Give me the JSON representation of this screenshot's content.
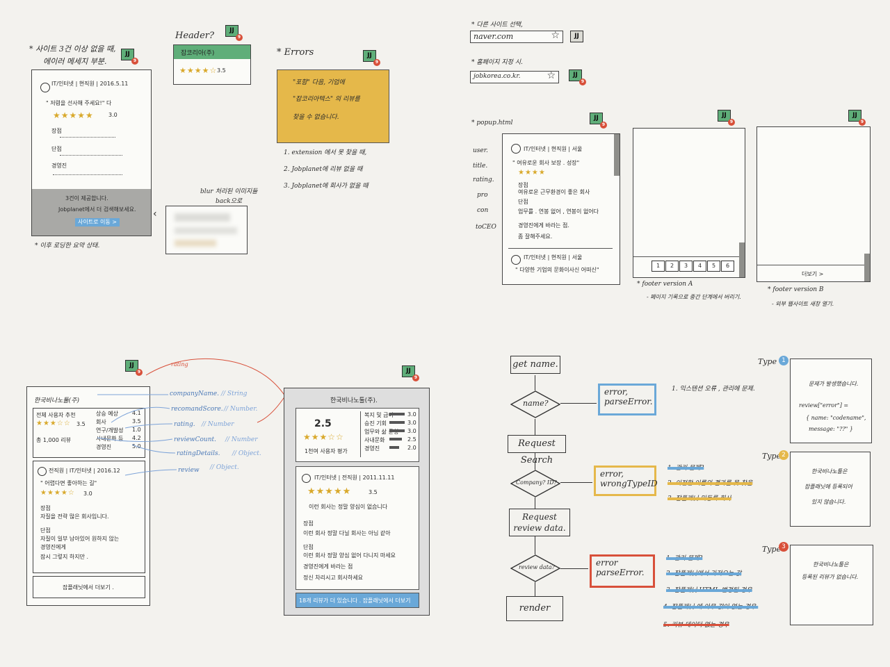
{
  "q1": {
    "note_top": "* 사이트 3건 이상 없을 때,",
    "note_top2": "에이러 메세지 부분.",
    "jj": "JJ",
    "card_review_header": "IT/인터넷 | 현직원 | 2016.5.11",
    "card_review_title": "\" 저렴을 선사해 주세요!\" 다",
    "card_score": "3.0",
    "label_pros": "장점",
    "label_cons": "단점",
    "label_wish": "경영진",
    "gray_line1": "3건이 제공합니다.",
    "gray_line2": "Jobplanet에서 더 검색해보세요.",
    "gray_button": "사이트로 이동 >",
    "note_bottom": "* 이후 로딩한 요약 상태.",
    "side_note": "blur 처리된 이미지들",
    "side_note2": "back으로",
    "header_q": "Header?",
    "header_company": "잡코리아(주)",
    "header_score": "3.5",
    "errors_title": "* Errors",
    "error_box_line1": "\"포함\" 다음, 기업에",
    "error_box_line2": "\"잡코리아텍스\" 의 리뷰를",
    "error_box_line3": "찾을 수 없습니다.",
    "errors_list": [
      "1. extension 에서 못 찾을 때,",
      "2. Jobplanet에 리뷰 없을 때",
      "3. Jobplanet에 회사가 없을 때"
    ]
  },
  "q2": {
    "note1": "* 다른 사이트 선택,",
    "site1": "naver.com",
    "note2": "* 홈페이지 지정 시.",
    "site2": "jobkorea.co.kr.",
    "popup_label": "* popup.html",
    "fields": [
      "user.",
      "title.",
      "rating.",
      "pro",
      "con",
      "toCEO"
    ],
    "popup_review1_header": "IT/인터넷 | 현직원 | 서울",
    "popup_review1_title": "\" 여유로운 회사 보장 . 성장\"",
    "popup_review1_lines": [
      "장점",
      "여유로운 근무환경이 좋은 회사",
      "단점",
      "업무를 . 연봉 없어 , 연봉이 없어다",
      "경영진에게 바라는 점.",
      "좀 잘해주세요."
    ],
    "popup_review2_header": "IT/인터넷 | 현직원 | 서울",
    "popup_review2_title": "\" 다양한 기업의 문화이사신 어떠신\"",
    "pager": [
      "1",
      "2",
      "3",
      "4",
      "5",
      "6"
    ],
    "more_btn": "더보기 >",
    "footer_a": "* footer version A",
    "footer_a_desc": "- 페이지 기록으로 중간 단계에서 버리기.",
    "footer_b": "* footer version B",
    "footer_b_desc": "- 외부 웹사이트 새창 열기."
  },
  "q3": {
    "rating_arrow": "rating",
    "company_title": "한국비나노툴(주)",
    "score_line1": "전체 사용자 추천",
    "score_num": "3.5",
    "score_line2": "총 1,000 리뷰",
    "details": [
      [
        "상승 예상",
        "4.1"
      ],
      [
        "회사",
        "3.5"
      ],
      [
        "연구/개발성",
        "1.0"
      ],
      [
        "사내문화 등",
        "4.2"
      ],
      [
        "경영진",
        "5.0"
      ]
    ],
    "review_header": "전직원 | IT/인터넷 | 2016.12",
    "review_title": "\" 어렵다면 좋아하는 길\"",
    "review_score": "3.0",
    "review_lines": [
      "장점",
      "자질을 전략 많은 회사입니다.",
      "단점",
      "자질이 일부 남아있어 원하지 않는",
      "경영진에게",
      "잠시 그렇지 하지만 ."
    ],
    "more_btn": "잡플래닛에서 더보기 .",
    "annot": [
      [
        "companyName.",
        "// String"
      ],
      [
        "recomandScore.",
        "// Number."
      ],
      [
        "rating.",
        "// Number"
      ],
      [
        "reviewCount.",
        "// Number"
      ],
      [
        "ratingDetails.",
        "// Object."
      ],
      [
        "review",
        "// Object."
      ]
    ],
    "right_title": "한국비나노툴(주).",
    "right_score": "2.5",
    "right_sub": "1천여 사용자 평가",
    "right_bars": [
      [
        "복지 및 급여",
        "3.0"
      ],
      [
        "승진 기회",
        "3.0"
      ],
      [
        "업무와 삶 균형",
        "3.0"
      ],
      [
        "사내문화",
        "2.5"
      ],
      [
        "경영진",
        "2.0"
      ]
    ],
    "right_review_header": "IT/인터넷 | 전직원 | 2011.11.11",
    "right_review_score": "3.5",
    "right_review_title": "이런 회사는 정말 양심이 없습니다",
    "right_review_lines": [
      "장점",
      "이런 회사 정말 다닐 회사는 아님 같아",
      "단점",
      "이런 회사 정말 양심 없어 다니지 마세요",
      "경영진에게 바라는 점",
      "정신 차리시고 회사하세요"
    ],
    "right_footer": "18개 리뷰가 더 있습니다 . 잡플래닛에서 더보기"
  },
  "q4": {
    "get_name": "get name.",
    "name_q": "name?",
    "request_search": "Request Search",
    "company_q": "Company? ID?",
    "request_review": "Request review data.",
    "review_q": "review data?",
    "render": "render",
    "err1_l1": "error,",
    "err1_l2": "parseError.",
    "err2_l1": "error,",
    "err2_l2": "wrongTypeID",
    "err3_l1": "error",
    "err3_l2": "parseError.",
    "type1": "Type",
    "type2": "Type",
    "type3": "Type",
    "badge1": "1",
    "badge2": "2",
    "badge3": "3",
    "type1_list": [
      "1. 익스텐션 오류 , 관리에 문제."
    ],
    "type2_list": [
      "1. 관리 문제?",
      "2. 이전한 이름의 결과를 못 찾음",
      "3. 잡플래닛 미등록 회사"
    ],
    "type3_list": [
      "1. 관리 문제?",
      "2. 잡플래닛에서 가져오는 값",
      "3. 잡플래닛 HTML 변경된 경우",
      "4. 잡플래닛 에 아무 값이 없는 경우.",
      "5. 리뷰 데이터 없는 경우"
    ],
    "panel1_l1": "문제가 발생했습니다.",
    "panel1_l2": "review[\"error\"] =",
    "panel1_l3": "{ name: \"codename\",",
    "panel1_l4": "message: \"??\" }",
    "panel2_l1": "한국비나노툴은",
    "panel2_l2": "잡플래닛에 등록되어",
    "panel2_l3": "있지 않습니다.",
    "panel3_l1": "한국비나노툴은",
    "panel3_l2": "등록된 리뷰가 없습니다."
  },
  "colors": {
    "green": "#5fae79",
    "orange": "#e5b84a",
    "blue": "#6aa8d8",
    "red": "#d8503a",
    "gray": "#a9a9a6"
  }
}
